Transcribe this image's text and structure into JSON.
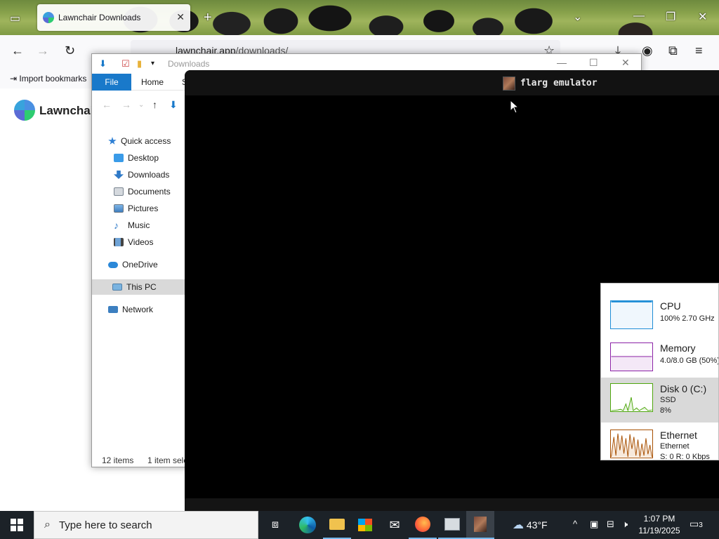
{
  "browser": {
    "tab_title": "Lawnchair Downloads",
    "url_host": "lawnchair.app",
    "url_path": "/downloads/",
    "bookmark_import": "Import bookmarks",
    "page_brand": "Lawnchai"
  },
  "explorer": {
    "title": "Downloads",
    "ribbon": {
      "file": "File",
      "home": "Home",
      "share": "Sh"
    },
    "nav": [
      {
        "label": "Quick access",
        "icon": "star-icon"
      },
      {
        "label": "Desktop",
        "icon": "desktop-icon"
      },
      {
        "label": "Downloads",
        "icon": "download-icon"
      },
      {
        "label": "Documents",
        "icon": "document-icon"
      },
      {
        "label": "Pictures",
        "icon": "picture-icon"
      },
      {
        "label": "Music",
        "icon": "music-icon"
      },
      {
        "label": "Videos",
        "icon": "video-icon"
      },
      {
        "label": "OneDrive",
        "icon": "cloud-icon"
      },
      {
        "label": "This PC",
        "icon": "computer-icon"
      },
      {
        "label": "Network",
        "icon": "network-icon"
      }
    ],
    "status_items": "12 items",
    "status_selected": "1 item sele"
  },
  "emulator": {
    "title": "flarg emulator"
  },
  "perf": [
    {
      "name": "CPU",
      "line1": "100%  2.70 GHz",
      "line2": "",
      "color": "#1f8dd6"
    },
    {
      "name": "Memory",
      "line1": "4.0/8.0 GB (50%)",
      "line2": "",
      "color": "#8b22a6"
    },
    {
      "name": "Disk 0 (C:)",
      "line1": "SSD",
      "line2": "8%",
      "color": "#4da60c"
    },
    {
      "name": "Ethernet",
      "line1": "Ethernet",
      "line2": "S: 0  R: 0 Kbps",
      "color": "#a74f01"
    }
  ],
  "taskbar": {
    "search_placeholder": "Type here to search",
    "weather": "43°F",
    "time": "1:07 PM",
    "date": "11/19/2025",
    "notifications": "3"
  }
}
